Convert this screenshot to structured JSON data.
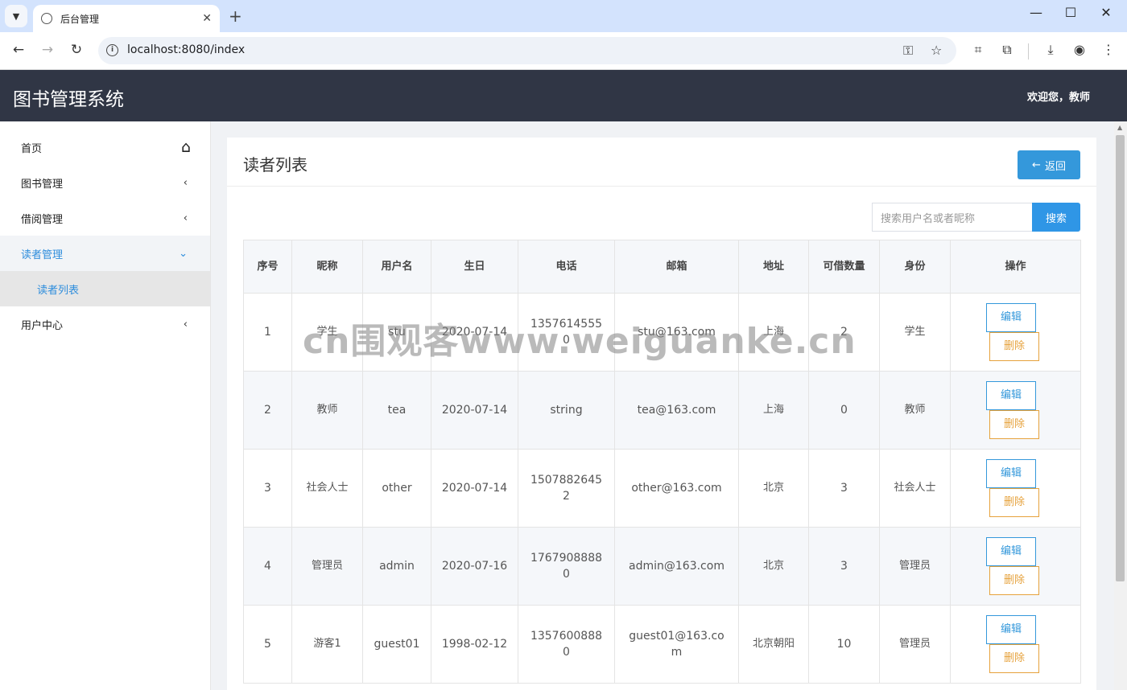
{
  "browser": {
    "tab_title": "后台管理",
    "url": "localhost:8080/index"
  },
  "header": {
    "app_title": "图书管理系统",
    "welcome": "欢迎您，教师"
  },
  "sidebar": {
    "items": [
      {
        "label": "首页"
      },
      {
        "label": "图书管理"
      },
      {
        "label": "借阅管理"
      },
      {
        "label": "读者管理"
      },
      {
        "label": "读者列表"
      },
      {
        "label": "用户中心"
      }
    ]
  },
  "main": {
    "title": "读者列表",
    "back_label": "返回",
    "search_placeholder": "搜索用户名或者昵称",
    "search_label": "搜索",
    "columns": [
      "序号",
      "昵称",
      "用户名",
      "生日",
      "电话",
      "邮箱",
      "地址",
      "可借数量",
      "身份",
      "操作"
    ],
    "rows": [
      {
        "no": "1",
        "nickname": "学生",
        "username": "stu",
        "birthday": "2020-07-14",
        "phone": "13576145550",
        "email": "stu@163.com",
        "address": "上海",
        "quota": "2",
        "role": "学生"
      },
      {
        "no": "2",
        "nickname": "教师",
        "username": "tea",
        "birthday": "2020-07-14",
        "phone": "string",
        "email": "tea@163.com",
        "address": "上海",
        "quota": "0",
        "role": "教师"
      },
      {
        "no": "3",
        "nickname": "社会人士",
        "username": "other",
        "birthday": "2020-07-14",
        "phone": "15078826452",
        "email": "other@163.com",
        "address": "北京",
        "quota": "3",
        "role": "社会人士"
      },
      {
        "no": "4",
        "nickname": "管理员",
        "username": "admin",
        "birthday": "2020-07-16",
        "phone": "17679088880",
        "email": "admin@163.com",
        "address": "北京",
        "quota": "3",
        "role": "管理员"
      },
      {
        "no": "5",
        "nickname": "游客1",
        "username": "guest01",
        "birthday": "1998-02-12",
        "phone": "13576008880",
        "email": "guest01@163.com",
        "address": "北京朝阳",
        "quota": "10",
        "role": "管理员"
      }
    ],
    "edit_label": "编辑",
    "delete_label": "删除"
  },
  "watermark": "cn围观客www.weiguanke.cn",
  "colors": {
    "header_bg": "#303645",
    "accent": "#3498db",
    "danger": "#e6a23c"
  }
}
